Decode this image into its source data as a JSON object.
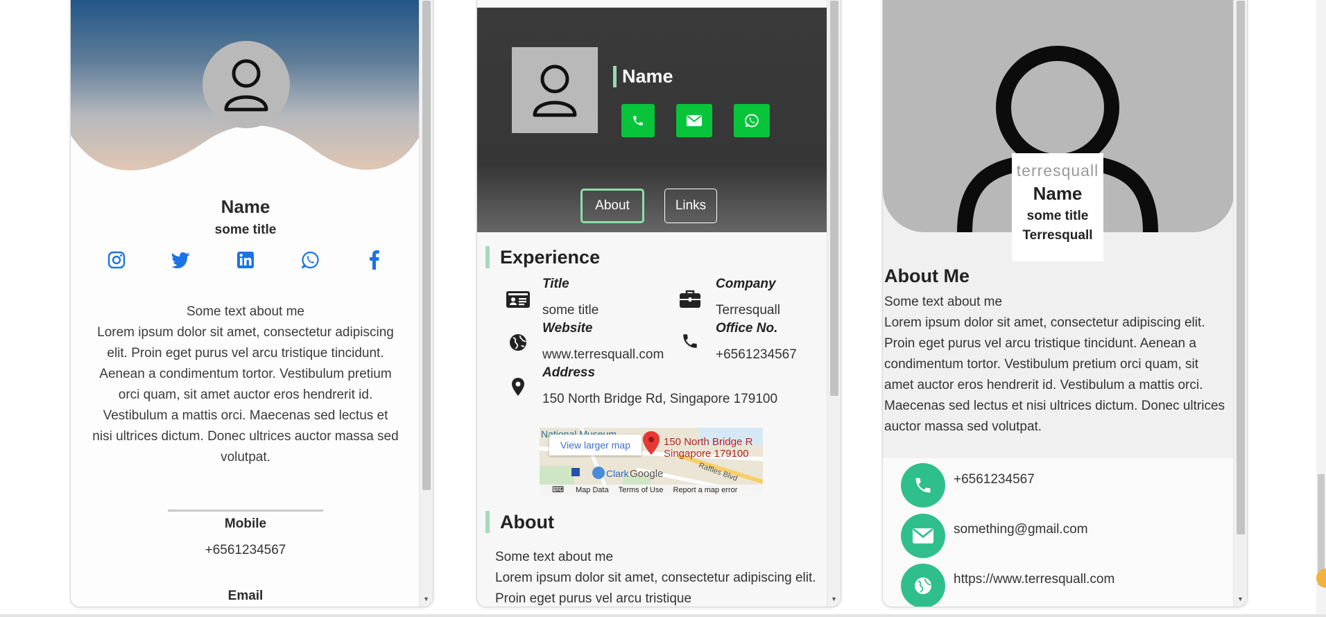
{
  "card1": {
    "name": "Name",
    "title": "some title",
    "socials": [
      "instagram",
      "twitter",
      "linkedin",
      "whatsapp",
      "facebook"
    ],
    "about_heading": "Some text about me",
    "about_text": "Lorem ipsum dolor sit amet, consectetur adipiscing elit. Proin eget purus vel arcu tristique tincidunt. Aenean a condimentum tortor. Vestibulum pretium orci quam, sit amet auctor eros hendrerit id. Vestibulum a mattis orci. Maecenas sed lectus et nisi ultrices dictum. Donec ultrices auctor massa sed volutpat.",
    "mobile_label": "Mobile",
    "mobile_value": "+6561234567",
    "email_label": "Email"
  },
  "card2": {
    "name": "Name",
    "tabs": [
      "About",
      "Links"
    ],
    "experience_heading": "Experience",
    "title_label": "Title",
    "title_value": "some title",
    "company_label": "Company",
    "company_value": "Terresquall",
    "website_label": "Website",
    "website_value": "www.terresquall.com",
    "office_label": "Office No.",
    "office_value": "+6561234567",
    "address_label": "Address",
    "address_value": "150 North Bridge Rd, Singapore 179100",
    "map": {
      "view_larger": "View larger map",
      "place_line1": "150 North Bridge R",
      "place_line2": "Singapore 179100",
      "museum": "National Museum",
      "clarke": "Clark",
      "google": "Google",
      "raffles": "Raffles Blvd",
      "footer": [
        "Map Data",
        "Terms of Use",
        "Report a map error"
      ]
    },
    "about_heading": "About",
    "about_text": "Some text about me\nLorem ipsum dolor sit amet, consectetur adipiscing elit. Proin eget purus vel arcu tristique"
  },
  "card3": {
    "brand": "terresquall",
    "name": "Name",
    "title": "some title",
    "company": "Terresquall",
    "about_heading": "About Me",
    "about_intro": "Some text about me",
    "about_text": "Lorem ipsum dolor sit amet, consectetur adipiscing elit. Proin eget purus vel arcu tristique tincidunt. Aenean a condimentum tortor. Vestibulum pretium orci quam, sit amet auctor eros hendrerit id. Vestibulum a mattis orci. Maecenas sed lectus et nisi ultrices dictum. Donec ultrices auctor massa sed volutpat.",
    "phone": "+6561234567",
    "email": "something@gmail.com",
    "website": "https://www.terresquall.com"
  },
  "colors": {
    "accent_green": "#07c43a",
    "teal": "#2fbf8c",
    "social_blue": "#1a73e8",
    "tab_active_border": "#8ee0a8"
  }
}
